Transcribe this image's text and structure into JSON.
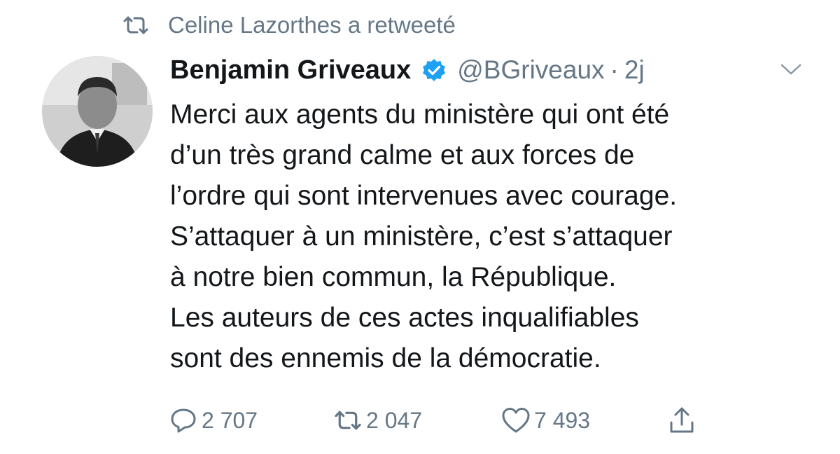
{
  "social_context": {
    "icon": "retweet-icon",
    "text": "Celine Lazorthes a retweeté"
  },
  "tweet": {
    "author": {
      "display_name": "Benjamin Griveaux",
      "verified": true,
      "handle": "@BGriveaux",
      "avatar": "author-avatar-photo"
    },
    "separator": "·",
    "time": "2j",
    "menu_icon": "chevron-down-icon",
    "text_lines": [
      "Merci aux agents du ministère qui ont été",
      "d’un très grand calme et aux forces de",
      "l’ordre qui sont intervenues avec courage.",
      "S’attaquer à un ministère, c’est s’attaquer",
      "à notre bien commun, la République.",
      "Les auteurs de ces actes inqualifiables",
      "sont des ennemis de la démocratie."
    ],
    "actions": {
      "reply": {
        "icon": "reply-icon",
        "count": "2 707"
      },
      "retweet": {
        "icon": "retweet-icon",
        "count": "2 047"
      },
      "like": {
        "icon": "heart-icon",
        "count": "7 493"
      },
      "share": {
        "icon": "share-icon"
      }
    }
  },
  "colors": {
    "text_primary": "#14171a",
    "text_secondary": "#657786",
    "verified_blue": "#1da1f2",
    "background": "#ffffff"
  }
}
